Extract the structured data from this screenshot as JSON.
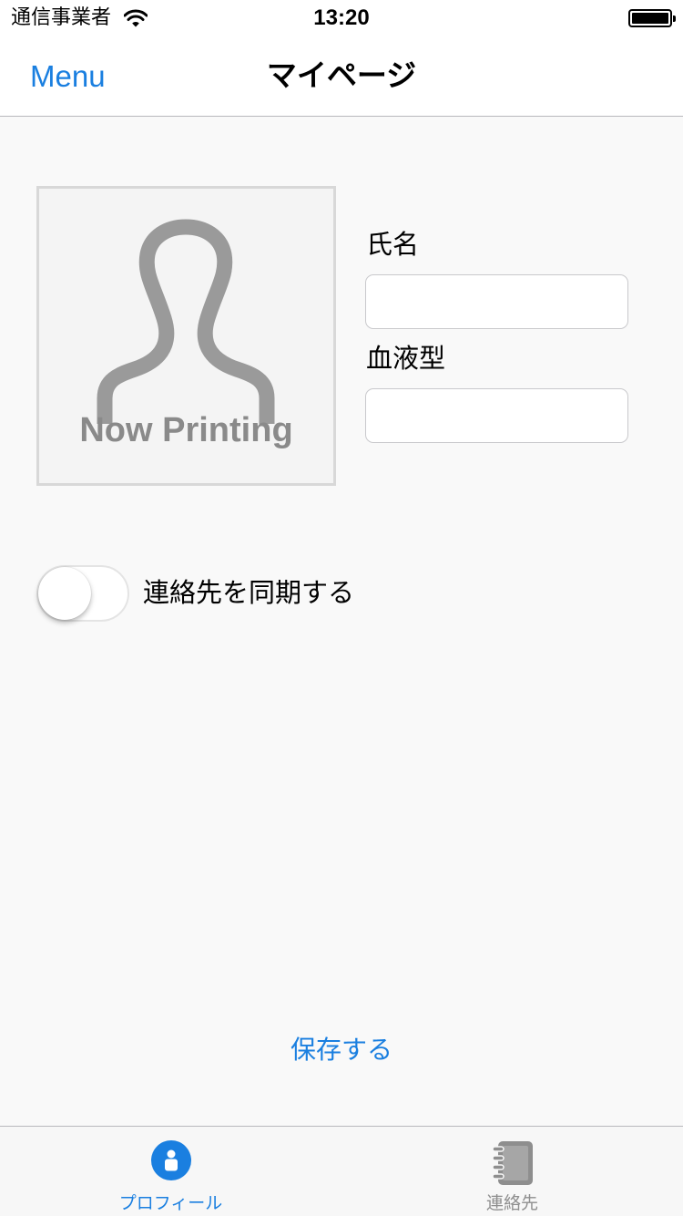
{
  "status_bar": {
    "carrier": "通信事業者",
    "time": "13:20",
    "battery_level": 1.0
  },
  "nav": {
    "menu_label": "Menu",
    "title": "マイページ"
  },
  "avatar": {
    "caption": "Now Printing"
  },
  "form": {
    "name_label": "氏名",
    "name_value": "",
    "blood_type_label": "血液型",
    "blood_type_value": ""
  },
  "sync_toggle": {
    "label": "連絡先を同期する",
    "on": false
  },
  "save_label": "保存する",
  "tabs": [
    {
      "label": "プロフィール",
      "icon": "profile-icon",
      "selected": true
    },
    {
      "label": "連絡先",
      "icon": "address-book-icon",
      "selected": false
    }
  ],
  "colors": {
    "accent": "#1a7fe0",
    "inactive": "#8e8e8e",
    "background": "#f9f9f9"
  }
}
